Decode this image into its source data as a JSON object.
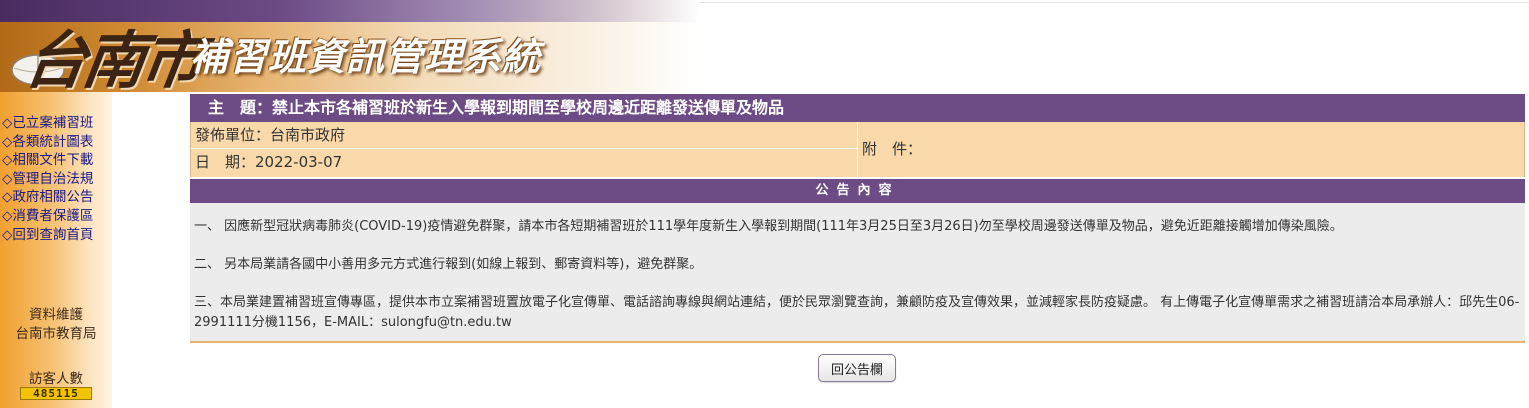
{
  "header": {
    "city_logo": "台南市",
    "system_title": "補習班資訊管理系統"
  },
  "sidebar": {
    "items": [
      {
        "label": "◇已立案補習班"
      },
      {
        "label": "◇各類統計圖表"
      },
      {
        "label": "◇相關文件下載"
      },
      {
        "label": "◇管理自治法規"
      },
      {
        "label": "◇政府相關公告"
      },
      {
        "label": "◇消費者保護區"
      },
      {
        "label": "◇回到查詢首頁"
      }
    ],
    "maintainer_label": "資料維護",
    "maintainer": "台南市教育局",
    "visitor_label": "訪客人數",
    "visitor_count": "485115"
  },
  "notice": {
    "subject": "主　題：禁止本市各補習班於新生入學報到期間至學校周邊近距離發送傳單及物品",
    "issuer": "發佈單位：台南市政府",
    "date": "日　期：2022-03-07",
    "attachment": "附　件：",
    "content_header": "公告內容",
    "paragraphs": [
      "一、 因應新型冠狀病毒肺炎(COVID-19)疫情避免群聚，請本市各短期補習班於111學年度新生入學報到期間(111年3月25日至3月26日)勿至學校周邊發送傳單及物品，避免近距離接觸增加傳染風險。",
      "二、 另本局業請各國中小善用多元方式進行報到(如線上報到、郵寄資料等)，避免群聚。",
      "三、本局業建置補習班宣傳專區，提供本市立案補習班置放電子化宣傳單、電話諮詢專線與網站連結，便於民眾瀏覽查詢，兼顧防疫及宣傳效果，並減輕家長防疫疑慮。 有上傳電子化宣傳單需求之補習班請洽本局承辦人：邱先生06-2991111分機1156，E-MAIL：sulongfu@tn.edu.tw"
    ],
    "back_button": "回公告欄"
  },
  "colors": {
    "header_purple": "#6d4c86",
    "meta_peach": "#f9d9aa",
    "body_gray": "#ececec",
    "sidebar_orange": "#f0a030",
    "link_blue": "#1a1a8a"
  },
  "icons": {
    "banner_graphic": "computer-mouse-icon"
  }
}
